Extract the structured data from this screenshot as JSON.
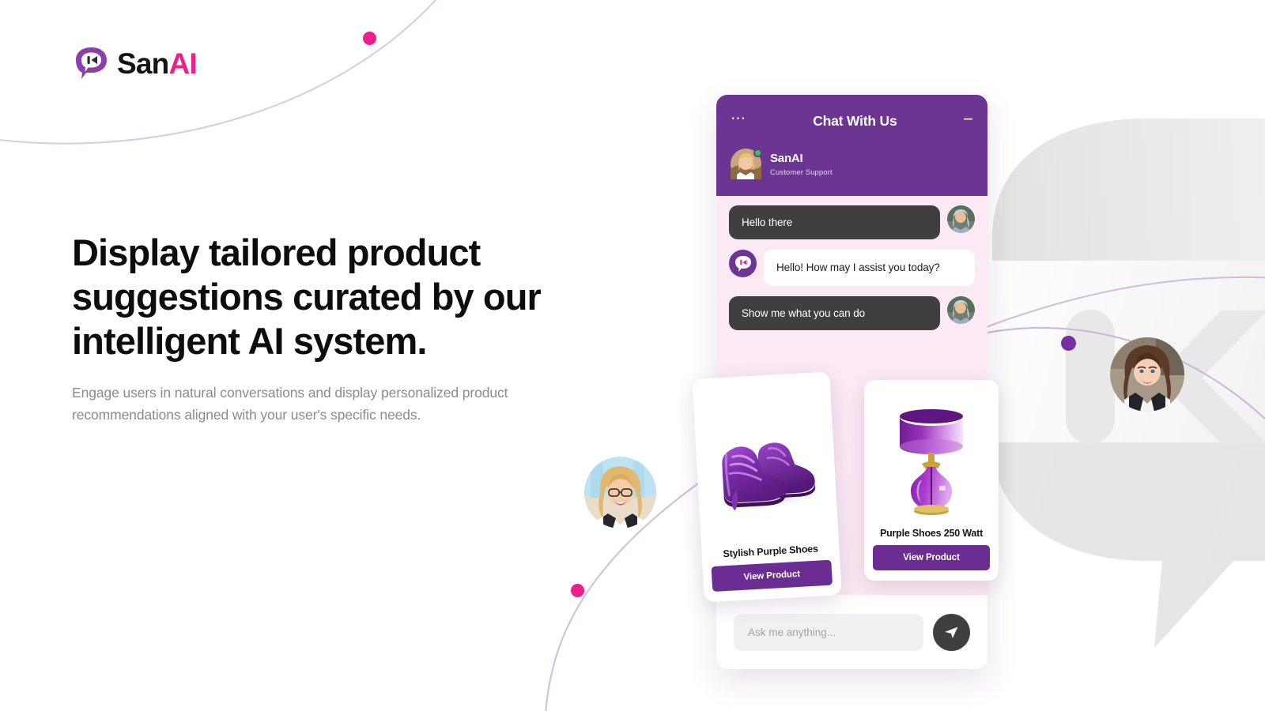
{
  "brand": {
    "name_part1": "San",
    "name_part2": "AI",
    "logo_icon": "sanai-bubble-logo-icon",
    "colors": {
      "purple": "#6C3493",
      "button_purple": "#6B2D91",
      "pink": "#EC1F8C",
      "chat_bg": "#FBE9F4",
      "user_bubble": "#403E3E",
      "status_online": "#24D442"
    }
  },
  "hero": {
    "headline": "Display tailored product suggestions curated by our intelligent AI system.",
    "subcopy": "Engage users in natural conversations and display personalized product recommendations aligned with your user's specific needs."
  },
  "widget": {
    "menu_icon": "more-options-icon",
    "title": "Chat With Us",
    "minimize_icon": "minimize-icon",
    "agent": {
      "name": "SanAI",
      "role": "Customer Support",
      "avatar": "agent-avatar",
      "status": "online"
    },
    "messages": [
      {
        "from": "user",
        "text": "Hello there",
        "avatar": "user-avatar"
      },
      {
        "from": "bot",
        "text": "Hello! How may I assist you today?",
        "avatar": "bot-logo-avatar"
      },
      {
        "from": "user",
        "text": "Show me what you can do",
        "avatar": "user-avatar"
      }
    ],
    "products": [
      {
        "title": "Stylish Purple Shoes",
        "button": "View Product",
        "image": "purple-sneakers-image"
      },
      {
        "title": "Purple Shoes 250 Watt",
        "button": "View Product",
        "image": "purple-table-lamp-image"
      }
    ],
    "composer": {
      "placeholder": "Ask me anything...",
      "value": "",
      "send_icon": "send-paper-plane-icon"
    }
  },
  "decor": {
    "avatar_left": "floating-avatar-woman-glasses",
    "avatar_right": "floating-avatar-woman-brunette",
    "watermark": "sanai-logo-watermark",
    "dots": [
      "pink-dot-top",
      "pink-dot-bottom",
      "purple-dot-right"
    ]
  }
}
